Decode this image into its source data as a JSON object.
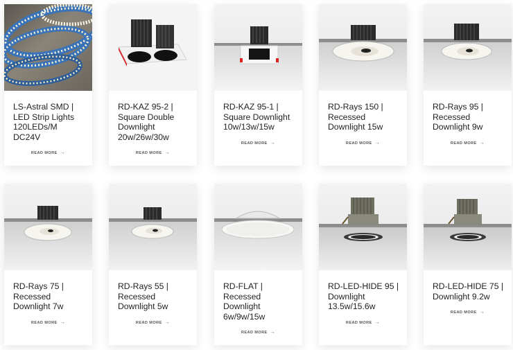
{
  "products": [
    {
      "title": "LS-Astral SMD | LED Strip Lights 120LEDs/M DC24V",
      "more": "READ MORE",
      "image_icon": "led-strip-icon"
    },
    {
      "title": "RD-KAZ 95-2 | Square Double Downlight 20w/26w/30w",
      "more": "READ MORE",
      "image_icon": "double-downlight-icon"
    },
    {
      "title": "RD-KAZ 95-1 | Square Downlight 10w/13w/15w",
      "more": "READ MORE",
      "image_icon": "square-downlight-icon"
    },
    {
      "title": "RD-Rays 150 | Recessed Downlight 15w",
      "more": "READ MORE",
      "image_icon": "recessed-downlight-icon"
    },
    {
      "title": "RD-Rays 95 | Recessed Downlight 9w",
      "more": "READ MORE",
      "image_icon": "recessed-downlight-icon"
    },
    {
      "title": "RD-Rays 75 | Recessed Downlight 7w",
      "more": "READ MORE",
      "image_icon": "recessed-downlight-icon"
    },
    {
      "title": "RD-Rays 55 | Recessed Downlight 5w",
      "more": "READ MORE",
      "image_icon": "recessed-downlight-icon"
    },
    {
      "title": "RD-FLAT | Recessed Downlight 6w/9w/15w",
      "more": "READ MORE",
      "image_icon": "flat-downlight-icon"
    },
    {
      "title": "RD-LED-HIDE 95 | Downlight 13.5w/15.6w",
      "more": "READ MORE",
      "image_icon": "hidden-downlight-icon"
    },
    {
      "title": "RD-LED-HIDE 75 | Downlight 9.2w",
      "more": "READ MORE",
      "image_icon": "hidden-downlight-icon"
    }
  ],
  "arrow": "→",
  "colors": {
    "ceiling": "#8d8d8d",
    "lamp_white": "#f7f5f0",
    "heatsink": "#2a2a2a",
    "strip_blue": "#3a73b8"
  }
}
